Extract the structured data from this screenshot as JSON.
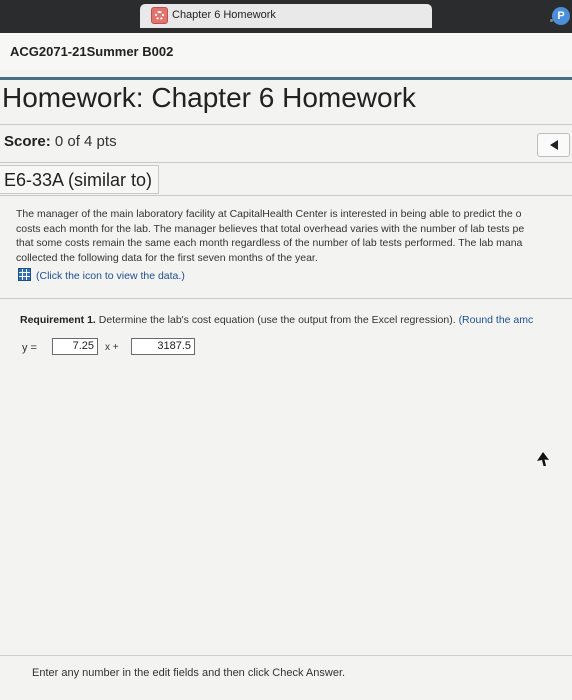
{
  "browser": {
    "tab_title": "Chapter 6 Homework",
    "profile_initial": "P"
  },
  "course": {
    "title": "ACG2071-21Summer B002"
  },
  "homework": {
    "title": "Homework: Chapter 6 Homework",
    "score_label": "Score:",
    "score_value": "0 of 4 pts"
  },
  "problem": {
    "tab_label": "E6-33A (similar to)",
    "body_lines": [
      "The manager of the main laboratory facility at CapitalHealth Center is interested in being able to predict the o",
      "costs each month for the lab. The manager believes that total overhead varies with the number of lab tests pe",
      "that some costs remain the same each month regardless of the number of lab tests performed. The lab mana",
      "collected the following data for the first seven months of the year."
    ],
    "data_link": "(Click the icon to view the data.)"
  },
  "requirement": {
    "label": "Requirement 1.",
    "text": "Determine the lab's cost equation (use the output from the Excel regression).",
    "note": "(Round the amc",
    "y_label": "y =",
    "slope_value": "7.25",
    "x_plus_label": "x +",
    "intercept_value": "3187.5"
  },
  "footer": {
    "instruction": "Enter any number in the edit fields and then click Check Answer."
  },
  "icons": {
    "favicon": "chapter-favicon-icon",
    "profile": "profile-icon",
    "prev": "triangle-left-icon",
    "data": "table-icon",
    "cursor": "mouse-cursor-icon"
  }
}
